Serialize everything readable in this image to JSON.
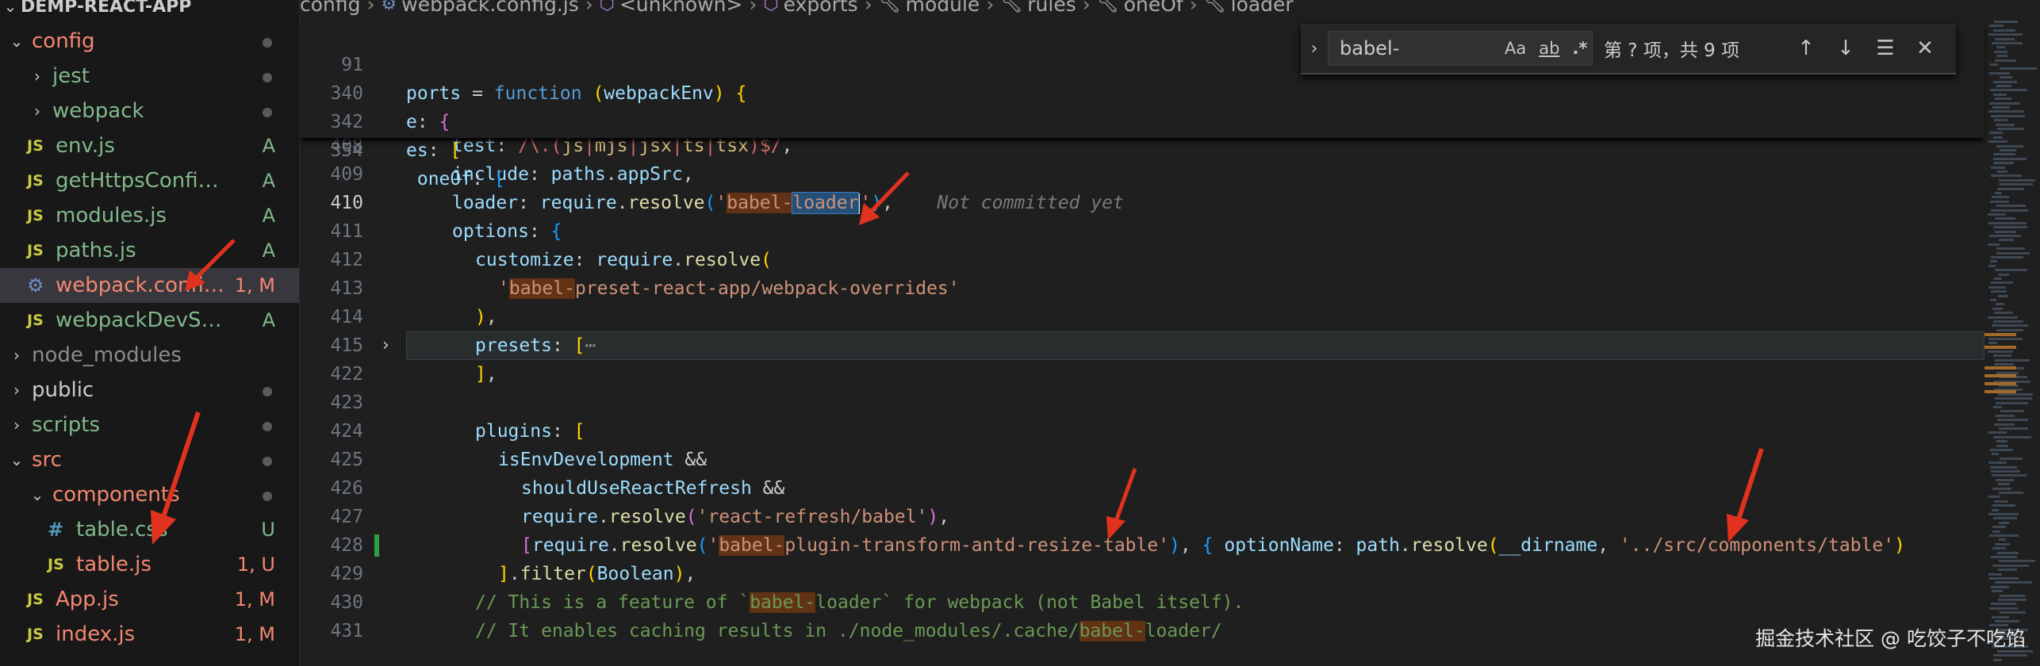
{
  "sidebar": {
    "root_title": "DEMP-REACT-APP",
    "items": [
      {
        "label": "config",
        "type": "folder-open",
        "indent": 0,
        "color": "error",
        "badge": "",
        "dot": true
      },
      {
        "label": "jest",
        "type": "folder",
        "indent": 1,
        "color": "added",
        "badge": "",
        "dot": true
      },
      {
        "label": "webpack",
        "type": "folder",
        "indent": 1,
        "color": "added",
        "badge": "",
        "dot": true
      },
      {
        "label": "env.js",
        "type": "js",
        "indent": 1,
        "color": "added",
        "badge": "A",
        "dot": false
      },
      {
        "label": "getHttpsConfig.js",
        "type": "js",
        "indent": 1,
        "color": "added",
        "badge": "A",
        "dot": false
      },
      {
        "label": "modules.js",
        "type": "js",
        "indent": 1,
        "color": "added",
        "badge": "A",
        "dot": false
      },
      {
        "label": "paths.js",
        "type": "js",
        "indent": 1,
        "color": "added",
        "badge": "A",
        "dot": false
      },
      {
        "label": "webpack.config.js",
        "type": "gear",
        "indent": 1,
        "color": "error",
        "badge": "1, M",
        "dot": false,
        "selected": true
      },
      {
        "label": "webpackDevServe...",
        "type": "js",
        "indent": 1,
        "color": "added",
        "badge": "A",
        "dot": false
      },
      {
        "label": "node_modules",
        "type": "folder",
        "indent": 0,
        "color": "dim",
        "badge": "",
        "dot": false
      },
      {
        "label": "public",
        "type": "folder",
        "indent": 0,
        "color": "plain",
        "badge": "",
        "dot": true
      },
      {
        "label": "scripts",
        "type": "folder",
        "indent": 0,
        "color": "added",
        "badge": "",
        "dot": true
      },
      {
        "label": "src",
        "type": "folder-open",
        "indent": 0,
        "color": "error",
        "badge": "",
        "dot": true
      },
      {
        "label": "components",
        "type": "folder-open",
        "indent": 1,
        "color": "error",
        "badge": "",
        "dot": true
      },
      {
        "label": "table.css",
        "type": "css",
        "indent": 2,
        "color": "added",
        "badge": "U",
        "dot": false
      },
      {
        "label": "table.js",
        "type": "js",
        "indent": 2,
        "color": "error",
        "badge": "1, U",
        "dot": false
      },
      {
        "label": "App.js",
        "type": "js",
        "indent": 1,
        "color": "error",
        "badge": "1, M",
        "dot": false
      },
      {
        "label": "index.js",
        "type": "js",
        "indent": 1,
        "color": "error",
        "badge": "1, M",
        "dot": false
      }
    ]
  },
  "breadcrumb": [
    "config",
    "webpack.config.js",
    "<unknown>",
    "exports",
    "module",
    "rules",
    "oneOf",
    "loader"
  ],
  "find": {
    "value": "babel-",
    "opt_case": "Aa",
    "opt_word": "ab",
    "opt_regex": ".*",
    "count": "第 ? 项，共 9 项"
  },
  "sticky": [
    {
      "ln": "91",
      "code": "ports = function (webpackEnv) {"
    },
    {
      "ln": "340",
      "code": "e: {"
    },
    {
      "ln": "342",
      "code": "es: ["
    },
    {
      "ln": "354",
      "code": " oneOf: ["
    }
  ],
  "lines": [
    {
      "ln": "407",
      "code": "{"
    },
    {
      "ln": "408",
      "code": "test: /\\.(js|mjs|jsx|ts|tsx)$/,"
    },
    {
      "ln": "409",
      "code": "include: paths.appSrc,"
    },
    {
      "ln": "410",
      "code": "loader: require.resolve('babel-loader'),",
      "blame": "Not committed yet"
    },
    {
      "ln": "411",
      "code": "options: {"
    },
    {
      "ln": "412",
      "code": "customize: require.resolve("
    },
    {
      "ln": "413",
      "code": "'babel-preset-react-app/webpack-overrides'"
    },
    {
      "ln": "414",
      "code": "),"
    },
    {
      "ln": "415",
      "code": "presets: [⋯"
    },
    {
      "ln": "422",
      "code": "],"
    },
    {
      "ln": "423",
      "code": ""
    },
    {
      "ln": "424",
      "code": "plugins: ["
    },
    {
      "ln": "425",
      "code": "isEnvDevelopment &&"
    },
    {
      "ln": "426",
      "code": "shouldUseReactRefresh &&"
    },
    {
      "ln": "427",
      "code": "require.resolve('react-refresh/babel'),"
    },
    {
      "ln": "428",
      "code": "[require.resolve('babel-plugin-transform-antd-resize-table'), { optionName: path.resolve(__dirname, '../src/components/table')"
    },
    {
      "ln": "429",
      "code": "].filter(Boolean),"
    },
    {
      "ln": "430",
      "code": "// This is a feature of `babel-loader` for webpack (not Babel itself)."
    },
    {
      "ln": "431",
      "code": "// It enables caching results in ./node_modules/.cache/babel-loader/"
    }
  ],
  "watermark": "掘金技术社区 @ 吃饺子不吃馅",
  "colors": {
    "selection": "#37373d",
    "find_match": "#613214",
    "current_match": "#264f78",
    "arrow": "#e0321e"
  }
}
